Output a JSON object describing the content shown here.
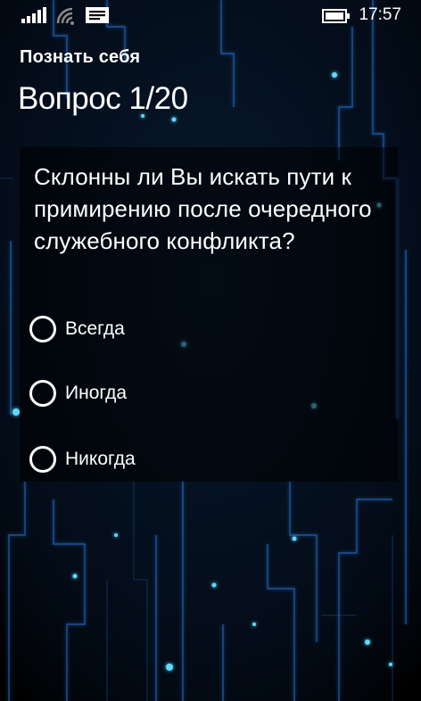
{
  "status_bar": {
    "time": "17:57",
    "icons": [
      "signal-icon",
      "wifi-icon",
      "message-icon",
      "battery-icon"
    ]
  },
  "app": {
    "title": "Познать себя"
  },
  "quiz": {
    "progress_label": "Вопрос 1/20",
    "question": "Склонны ли Вы искать пути к примирению после очередного служебного конфликта?",
    "options": [
      {
        "label": "Всегда",
        "selected": false
      },
      {
        "label": "Иногда",
        "selected": false
      },
      {
        "label": "Никогда",
        "selected": false
      }
    ]
  },
  "colors": {
    "background": "#02060d",
    "circuit_glow": "#2f8fff",
    "panel": "#000000",
    "text": "#ffffff"
  }
}
